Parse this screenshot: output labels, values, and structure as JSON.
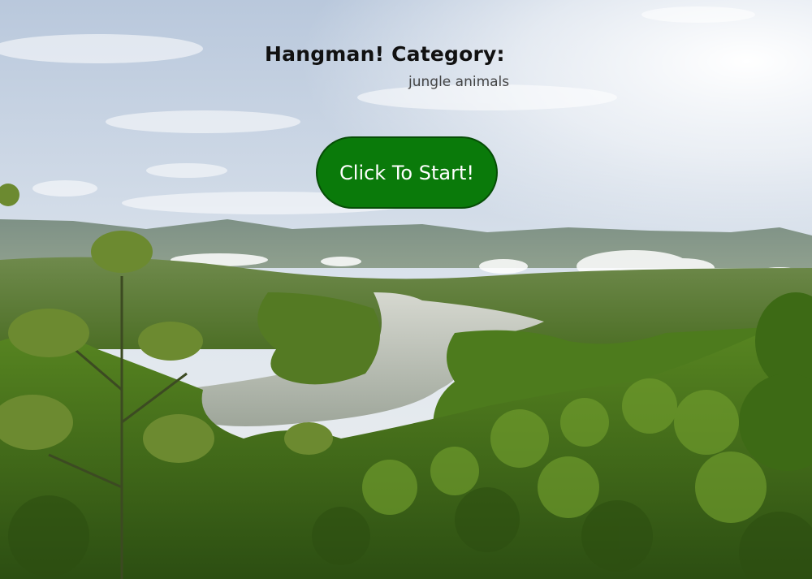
{
  "page": {
    "title": "Hangman! Category:",
    "category": "jungle animals",
    "start_button_label": "Click To Start!"
  },
  "background": {
    "scene": "jungle-lake-landscape",
    "sky_color": "#dfe6ee",
    "forest_color": "#3f6f1c",
    "water_color": "#c9ccc6"
  },
  "colors": {
    "button_fill": "#0a7a0a",
    "button_border": "#064d06",
    "button_text": "#ffffff",
    "title_text": "#111111",
    "category_text": "#444444"
  }
}
